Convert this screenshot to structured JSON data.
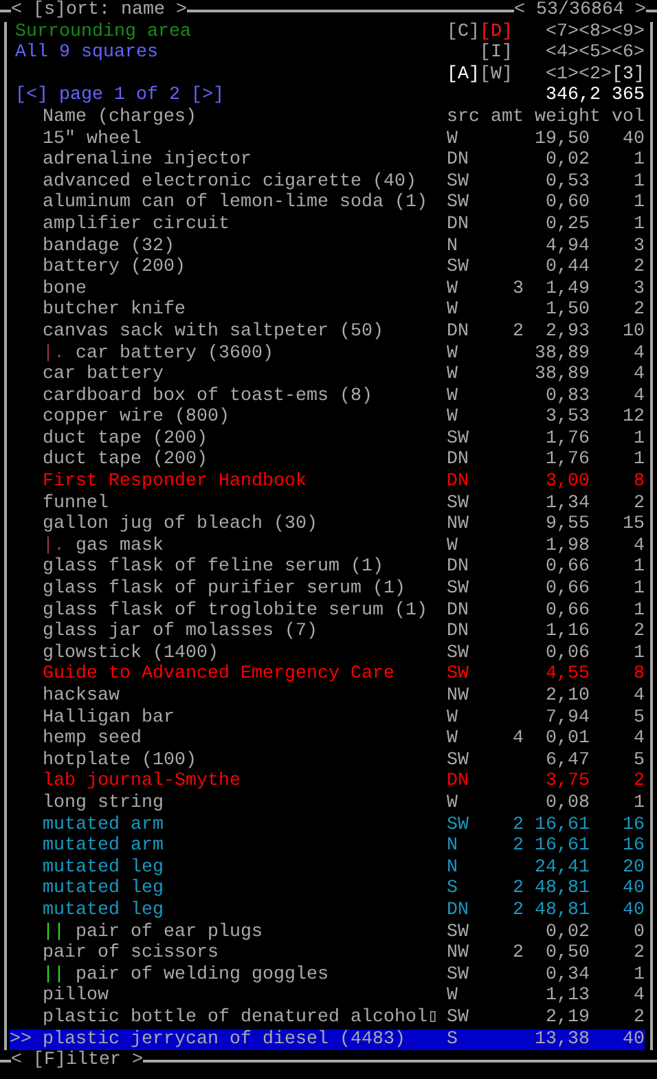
{
  "frame": {
    "title_left": "< [s]ort: name >",
    "title_right": "< 53/36864 >",
    "footer": "< [F]ilter >"
  },
  "pane": {
    "location": "Surrounding area",
    "area": "All 9 squares",
    "pager": {
      "prev": "[<]",
      "label": "page 1 of 2",
      "next": "[>]"
    },
    "totals": "346,2 365",
    "key_rows": [
      {
        "keys": [
          {
            "label": "[C]",
            "color": "#a8a8a8"
          },
          {
            "label": "[D]",
            "color": "#ff1818"
          }
        ],
        "dirs": [
          {
            "label": "<7>",
            "color": "#a8a8a8"
          },
          {
            "label": "<8>",
            "color": "#a8a8a8"
          },
          {
            "label": "<9>",
            "color": "#a8a8a8"
          }
        ]
      },
      {
        "keys": [
          {
            "label": "[I]",
            "color": "#a8a8a8"
          }
        ],
        "dirs": [
          {
            "label": "<4>",
            "color": "#a8a8a8"
          },
          {
            "label": "<5>",
            "color": "#a8a8a8"
          },
          {
            "label": "<6>",
            "color": "#a8a8a8"
          }
        ]
      },
      {
        "keys": [
          {
            "label": "[A]",
            "color": "#ffffff"
          },
          {
            "label": "[W]",
            "color": "#a8a8a8"
          }
        ],
        "dirs": [
          {
            "label": "<1>",
            "color": "#a8a8a8"
          },
          {
            "label": "<2>",
            "color": "#a8a8a8"
          },
          {
            "label": "[3]",
            "color": "#d8d8d8"
          }
        ]
      }
    ]
  },
  "columns": [
    "Name (charges)",
    "src",
    "amt",
    "weight",
    "vol"
  ],
  "cursor": ">>",
  "items": [
    {
      "name": "15\" wheel",
      "src": "W",
      "weight": "19,50",
      "vol": "40",
      "color": "#a8a8a8",
      "selected": false
    },
    {
      "name": "adrenaline injector",
      "src": "DN",
      "weight": "0,02",
      "vol": "1",
      "color": "#a8a8a8",
      "selected": false
    },
    {
      "name": "advanced electronic cigarette (40)",
      "src": "SW",
      "weight": "0,53",
      "vol": "1",
      "color": "#a8a8a8",
      "selected": false
    },
    {
      "name": "aluminum can of lemon-lime soda (1)",
      "src": "SW",
      "weight": "0,60",
      "vol": "1",
      "color": "#a8a8a8",
      "selected": false
    },
    {
      "name": "amplifier circuit",
      "src": "DN",
      "weight": "0,25",
      "vol": "1",
      "color": "#a8a8a8",
      "selected": false
    },
    {
      "name": "bandage (32)",
      "src": "N",
      "weight": "4,94",
      "vol": "3",
      "color": "#a8a8a8",
      "selected": false
    },
    {
      "name": "battery (200)",
      "src": "SW",
      "weight": "0,44",
      "vol": "2",
      "color": "#a8a8a8",
      "selected": false
    },
    {
      "name": "bone",
      "src": "W",
      "amt": "3",
      "weight": "1,49",
      "vol": "3",
      "color": "#a8a8a8",
      "selected": false
    },
    {
      "name": "butcher knife",
      "src": "W",
      "weight": "1,50",
      "vol": "2",
      "color": "#a8a8a8",
      "selected": false
    },
    {
      "name": "canvas sack with saltpeter (50)",
      "src": "DN",
      "amt": "2",
      "weight": "2,93",
      "vol": "10",
      "color": "#a8a8a8",
      "selected": false
    },
    {
      "prefix": {
        "text": "|.",
        "color": "#a0305c"
      },
      "name": "car battery (3600)",
      "src": "W",
      "weight": "38,89",
      "vol": "4",
      "color": "#a8a8a8",
      "selected": false
    },
    {
      "name": "car battery",
      "src": "W",
      "weight": "38,89",
      "vol": "4",
      "color": "#a8a8a8",
      "selected": false
    },
    {
      "name": "cardboard box of toast-ems (8)",
      "src": "W",
      "weight": "0,83",
      "vol": "4",
      "color": "#a8a8a8",
      "selected": false
    },
    {
      "name": "copper wire (800)",
      "src": "W",
      "weight": "3,53",
      "vol": "12",
      "color": "#a8a8a8",
      "selected": false
    },
    {
      "name": "duct tape (200)",
      "src": "SW",
      "weight": "1,76",
      "vol": "1",
      "color": "#a8a8a8",
      "selected": false
    },
    {
      "name": "duct tape (200)",
      "src": "DN",
      "weight": "1,76",
      "vol": "1",
      "color": "#a8a8a8",
      "selected": false
    },
    {
      "name": "First Responder Handbook",
      "src": "DN",
      "weight": "3,00",
      "vol": "8",
      "color": "#ff0000",
      "selected": false
    },
    {
      "name": "funnel",
      "src": "SW",
      "weight": "1,34",
      "vol": "2",
      "color": "#a8a8a8",
      "selected": false
    },
    {
      "name": "gallon jug of bleach (30)",
      "src": "NW",
      "weight": "9,55",
      "vol": "15",
      "color": "#a8a8a8",
      "selected": false
    },
    {
      "prefix": {
        "text": "|.",
        "color": "#a0305c"
      },
      "name": "gas mask",
      "src": "W",
      "weight": "1,98",
      "vol": "4",
      "color": "#a8a8a8",
      "selected": false
    },
    {
      "name": "glass flask of feline serum (1)",
      "src": "DN",
      "weight": "0,66",
      "vol": "1",
      "color": "#a8a8a8",
      "selected": false
    },
    {
      "name": "glass flask of purifier serum (1)",
      "src": "SW",
      "weight": "0,66",
      "vol": "1",
      "color": "#a8a8a8",
      "selected": false
    },
    {
      "name": "glass flask of troglobite serum (1)",
      "src": "DN",
      "weight": "0,66",
      "vol": "1",
      "color": "#a8a8a8",
      "selected": false
    },
    {
      "name": "glass jar of molasses (7)",
      "src": "DN",
      "weight": "1,16",
      "vol": "2",
      "color": "#a8a8a8",
      "selected": false
    },
    {
      "name": "glowstick (1400)",
      "src": "SW",
      "weight": "0,06",
      "vol": "1",
      "color": "#a8a8a8",
      "selected": false
    },
    {
      "name": "Guide to Advanced Emergency Care",
      "src": "SW",
      "weight": "4,55",
      "vol": "8",
      "color": "#ff0000",
      "selected": false
    },
    {
      "name": "hacksaw",
      "src": "NW",
      "weight": "2,10",
      "vol": "4",
      "color": "#a8a8a8",
      "selected": false
    },
    {
      "name": "Halligan bar",
      "src": "W",
      "weight": "7,94",
      "vol": "5",
      "color": "#a8a8a8",
      "selected": false
    },
    {
      "name": "hemp seed",
      "src": "W",
      "amt": "4",
      "weight": "0,01",
      "vol": "4",
      "color": "#a8a8a8",
      "selected": false
    },
    {
      "name": "hotplate (100)",
      "src": "SW",
      "weight": "6,47",
      "vol": "5",
      "color": "#a8a8a8",
      "selected": false
    },
    {
      "name": "lab journal-Smythe",
      "src": "DN",
      "weight": "3,75",
      "vol": "2",
      "color": "#ff0000",
      "selected": false
    },
    {
      "name": "long string",
      "src": "W",
      "weight": "0,08",
      "vol": "1",
      "color": "#a8a8a8",
      "selected": false
    },
    {
      "name": "mutated arm",
      "src": "SW",
      "amt": "2",
      "weight": "16,61",
      "vol": "16",
      "color": "#1898c0",
      "selected": false
    },
    {
      "name": "mutated arm",
      "src": "N",
      "amt": "2",
      "weight": "16,61",
      "vol": "16",
      "color": "#1898c0",
      "selected": false
    },
    {
      "name": "mutated leg",
      "src": "N",
      "weight": "24,41",
      "vol": "20",
      "color": "#1898c0",
      "selected": false
    },
    {
      "name": "mutated leg",
      "src": "S",
      "amt": "2",
      "weight": "48,81",
      "vol": "40",
      "color": "#1898c0",
      "selected": false
    },
    {
      "name": "mutated leg",
      "src": "DN",
      "amt": "2",
      "weight": "48,81",
      "vol": "40",
      "color": "#1898c0",
      "selected": false
    },
    {
      "prefix": {
        "text": "||",
        "color": "#20e020"
      },
      "name": "pair of ear plugs",
      "src": "SW",
      "weight": "0,02",
      "vol": "0",
      "color": "#a8a8a8",
      "selected": false
    },
    {
      "name": "pair of scissors",
      "src": "NW",
      "amt": "2",
      "weight": "0,50",
      "vol": "2",
      "color": "#a8a8a8",
      "selected": false
    },
    {
      "prefix": {
        "text": "||",
        "color": "#20e020"
      },
      "name": "pair of welding goggles",
      "src": "SW",
      "weight": "0,34",
      "vol": "1",
      "color": "#a8a8a8",
      "selected": false
    },
    {
      "name": "pillow",
      "src": "W",
      "weight": "1,13",
      "vol": "4",
      "color": "#a8a8a8",
      "selected": false
    },
    {
      "name": "plastic bottle of denatured alcohol▯",
      "src": "SW",
      "weight": "2,19",
      "vol": "2",
      "color": "#a8a8a8",
      "selected": false
    },
    {
      "name": "plastic jerrycan of diesel (4483)",
      "src": "S",
      "weight": "13,38",
      "vol": "40",
      "selected": true
    }
  ]
}
